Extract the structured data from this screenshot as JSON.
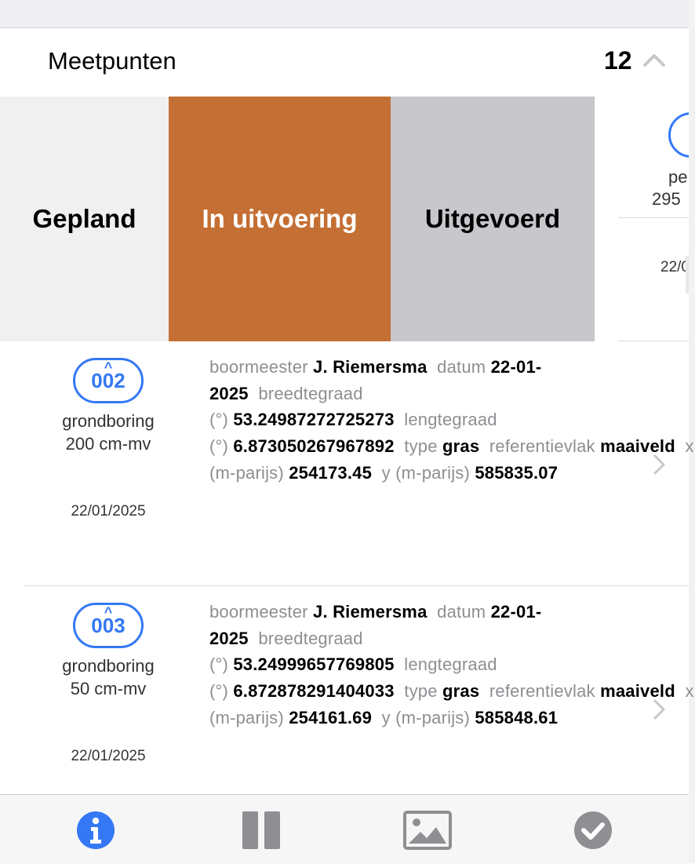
{
  "section": {
    "title": "Meetpunten",
    "count": "12"
  },
  "swipe_actions": {
    "planned": "Gepland",
    "in_progress": "In uitvoering",
    "done": "Uitgevoerd"
  },
  "peek": {
    "type_partial": "pe",
    "depth_partial": "295",
    "date_partial": "22/0"
  },
  "rows": [
    {
      "code": "002",
      "type": "grondboring",
      "depth": "200 cm-mv",
      "date": "22/01/2025",
      "details": [
        {
          "k": "boormeester",
          "v": "J. Riemersma"
        },
        {
          "k": "datum",
          "v": "22-01-2025"
        },
        {
          "k": "breedtegraad (°)",
          "v": "53.24987272725273"
        },
        {
          "k": "lengtegraad (°)",
          "v": "6.873050267967892"
        },
        {
          "k": "type",
          "v": "gras"
        },
        {
          "k": "referentievlak",
          "v": "maaiveld"
        },
        {
          "k": "x (m-parijs)",
          "v": "254173.45"
        },
        {
          "k": "y (m-parijs)",
          "v": "585835.07"
        }
      ]
    },
    {
      "code": "003",
      "type": "grondboring",
      "depth": "50 cm-mv",
      "date": "22/01/2025",
      "details": [
        {
          "k": "boormeester",
          "v": "J. Riemersma"
        },
        {
          "k": "datum",
          "v": "22-01-2025"
        },
        {
          "k": "breedtegraad (°)",
          "v": "53.24999657769805"
        },
        {
          "k": "lengtegraad (°)",
          "v": "6.872878291404033"
        },
        {
          "k": "type",
          "v": "gras"
        },
        {
          "k": "referentievlak",
          "v": "maaiveld"
        },
        {
          "k": "x (m-parijs)",
          "v": "254161.69"
        },
        {
          "k": "y (m-parijs)",
          "v": "585848.61"
        }
      ]
    }
  ],
  "tabbar": [
    "info-icon",
    "columns-icon",
    "image-icon",
    "checkmark-icon"
  ],
  "colors": {
    "accent": "#3478f6",
    "in_progress": "#c46f33",
    "done": "#c7c7cc",
    "planned": "#f0f0f0",
    "tab_active": "#3478f6",
    "tab_inactive": "#8e8e93"
  }
}
